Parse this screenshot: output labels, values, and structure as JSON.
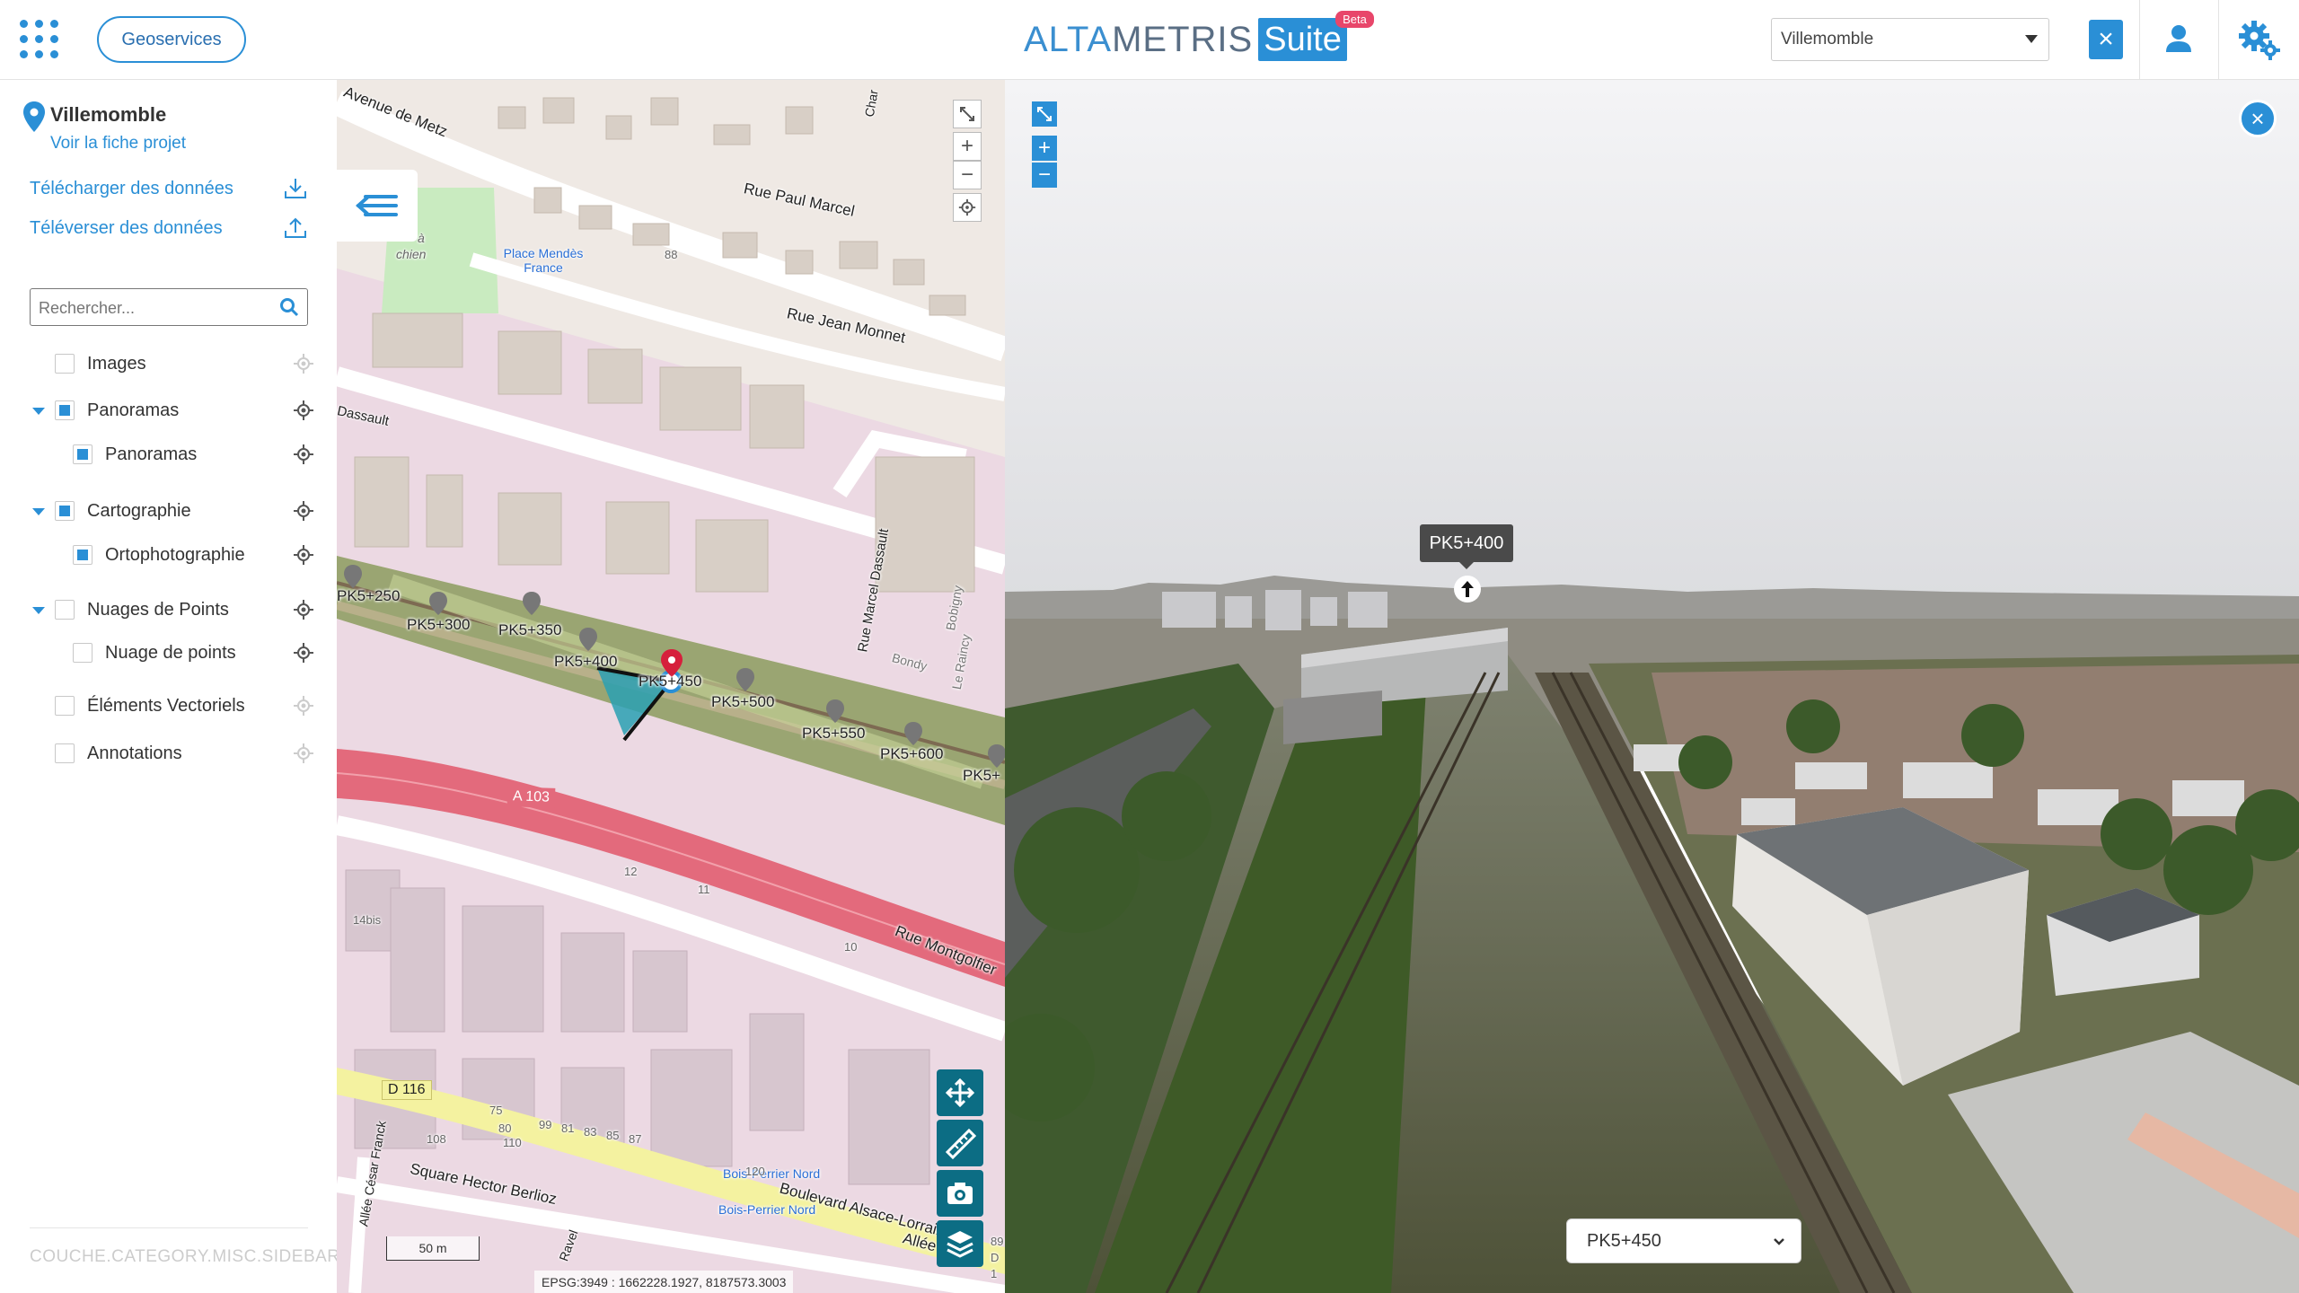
{
  "header": {
    "geoservices_label": "Geoservices",
    "brand": {
      "alta": "ALTA",
      "metris": "METRIS",
      "suite": "Suite",
      "beta": "Beta"
    },
    "project_select_value": "Villemomble",
    "clear_label": "×"
  },
  "sidebar": {
    "project_title": "Villemomble",
    "project_link": "Voir la fiche projet",
    "download_label": "Télécharger des données",
    "upload_label": "Téléverser des données",
    "search_placeholder": "Rechercher...",
    "layers": [
      {
        "label": "Images",
        "checked": false
      },
      {
        "label": "Panoramas",
        "checked": true
      },
      {
        "label": "Panoramas",
        "checked": true
      },
      {
        "label": "Cartographie",
        "checked": true
      },
      {
        "label": "Ortophotographie",
        "checked": true
      },
      {
        "label": "Nuages de Points",
        "checked": false
      },
      {
        "label": "Nuage de points",
        "checked": false
      },
      {
        "label": "Éléments Vectoriels",
        "checked": false
      },
      {
        "label": "Annotations",
        "checked": false
      }
    ],
    "footer": "COUCHE.CATEGORY.MISC.SIDEBAR"
  },
  "map": {
    "streets": [
      "Avenue de Metz",
      "Rue Paul Marcel",
      "Rue Jean Monnet",
      "Rue Marcel Dassault",
      "Rue Montgolfier",
      "Boulevard Alsace-Lorraine",
      "Square Hector Berlioz",
      "Allée César Franck",
      "Allée",
      "Dassault",
      "Bobigny",
      "Le Raincy",
      "Bondy",
      "Char",
      "Ravel"
    ],
    "places": [
      "Place Mendès France",
      "Bois-Perrier Nord",
      "Bois-Perrier Nord",
      "chien",
      "à"
    ],
    "roads": [
      "A 103",
      "D 116"
    ],
    "house_numbers": [
      "88",
      "14bis",
      "12",
      "11",
      "10",
      "75",
      "80",
      "108",
      "110",
      "120",
      "99",
      "81",
      "83",
      "85",
      "87",
      "89",
      "D",
      "1",
      "8"
    ],
    "pk_markers": [
      "PK5+250",
      "PK5+300",
      "PK5+350",
      "PK5+400",
      "PK5+450",
      "PK5+500",
      "PK5+550",
      "PK5+600",
      "PK5+"
    ],
    "scale_label": "50 m",
    "coordinates": "EPSG:3949 : 1662228.1927, 8187573.3003",
    "zoom_in": "+",
    "zoom_out": "−"
  },
  "panorama": {
    "tooltip": "PK5+400",
    "selected_pk": "PK5+450",
    "zoom_in": "+",
    "zoom_out": "−",
    "close_label": "×"
  },
  "colors": {
    "accent": "#2a8fd6",
    "map_tool": "#0c6d84",
    "road_highway": "#e36a7c",
    "road_secondary": "#f4f2a0"
  }
}
